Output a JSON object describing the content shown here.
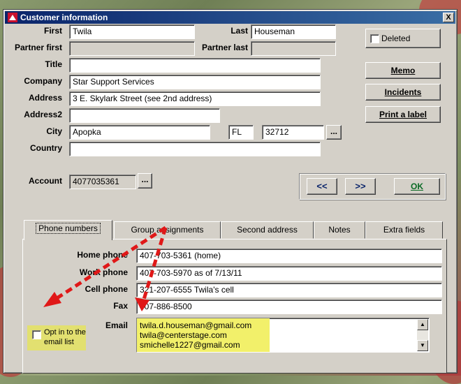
{
  "window": {
    "title": "Customer information",
    "close_label": "X"
  },
  "labels": {
    "first": "First",
    "last": "Last",
    "partner_first": "Partner first",
    "partner_last": "Partner last",
    "title": "Title",
    "company": "Company",
    "address": "Address",
    "address2": "Address2",
    "city": "City",
    "country": "Country",
    "account": "Account"
  },
  "values": {
    "first": "Twila",
    "last": "Houseman",
    "partner_first": "",
    "partner_last": "",
    "title": "",
    "company": "Star Support Services",
    "address": "3 E. Skylark Street (see 2nd address)",
    "address2": "",
    "city": "Apopka",
    "state": "FL",
    "zip": "32712",
    "country": "",
    "account": "4077035361"
  },
  "buttons": {
    "deleted": "Deleted",
    "memo": "Memo",
    "incidents": "Incidents",
    "print_label": "Print a label",
    "prev": "<<",
    "next": ">>",
    "ok": "OK",
    "dots": "..."
  },
  "tabs": [
    "Phone numbers",
    "Group assignments",
    "Second address",
    "Notes",
    "Extra fields"
  ],
  "phone": {
    "home_label": "Home phone",
    "home": "407-703-5361 (home)",
    "work_label": "Work phone",
    "work": "407-703-5970 as of 7/13/11",
    "cell_label": "Cell phone",
    "cell": "321-207-6555 Twila's cell",
    "fax_label": "Fax",
    "fax": "407-886-8500",
    "email_label": "Email",
    "emails": [
      "twila.d.houseman@gmail.com",
      "twila@centerstage.com",
      "smichelle1227@gmail.com"
    ],
    "optin_line1": "Opt in to the",
    "optin_line2": "email list"
  },
  "colors": {
    "highlight": "#f2f06a",
    "arrow": "#e01818",
    "title_bar": "#0a246a"
  }
}
